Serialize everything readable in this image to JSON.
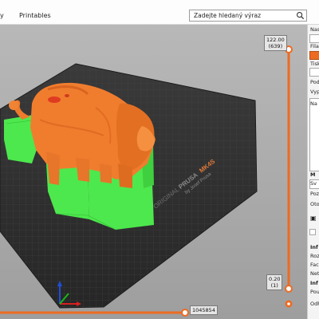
{
  "menu": {
    "partial_item": "y",
    "printables": "Printables"
  },
  "search": {
    "placeholder": "Zadejte hledaný výraz"
  },
  "sidebar": {
    "nast": "Nast",
    "filam": "Filam",
    "tisk": "Tiskár",
    "podp": "Podp",
    "vypl": "Vypl",
    "na": "Na",
    "m": "M",
    "sv": "Sv",
    "poz": "Poz",
    "oto": "Oto",
    "inf1": "Inf",
    "roz": "Roz",
    "face": "Face",
    "net": "Net",
    "inf2": "Inf",
    "pou": "Pou",
    "odh": "Odh"
  },
  "bed": {
    "brand_prefix": "ORIGINAL",
    "brand_prusa": "PRUSA",
    "brand_model": "MK4S",
    "brand_by": "by Josef Prusa"
  },
  "layer_slider": {
    "top_height": "122.00",
    "top_layer": "(639)",
    "bottom_height": "0.20",
    "bottom_layer": "(1)"
  },
  "move_slider": {
    "value": "1045854"
  },
  "colors": {
    "accent": "#ed6b21",
    "model_orange": "#f07d2e",
    "support_green": "#4de84d",
    "bed_dark": "#2e2e2e"
  },
  "icons": {
    "search": "magnifier",
    "settings_gear": "gear",
    "axes": "xyz-axes"
  }
}
